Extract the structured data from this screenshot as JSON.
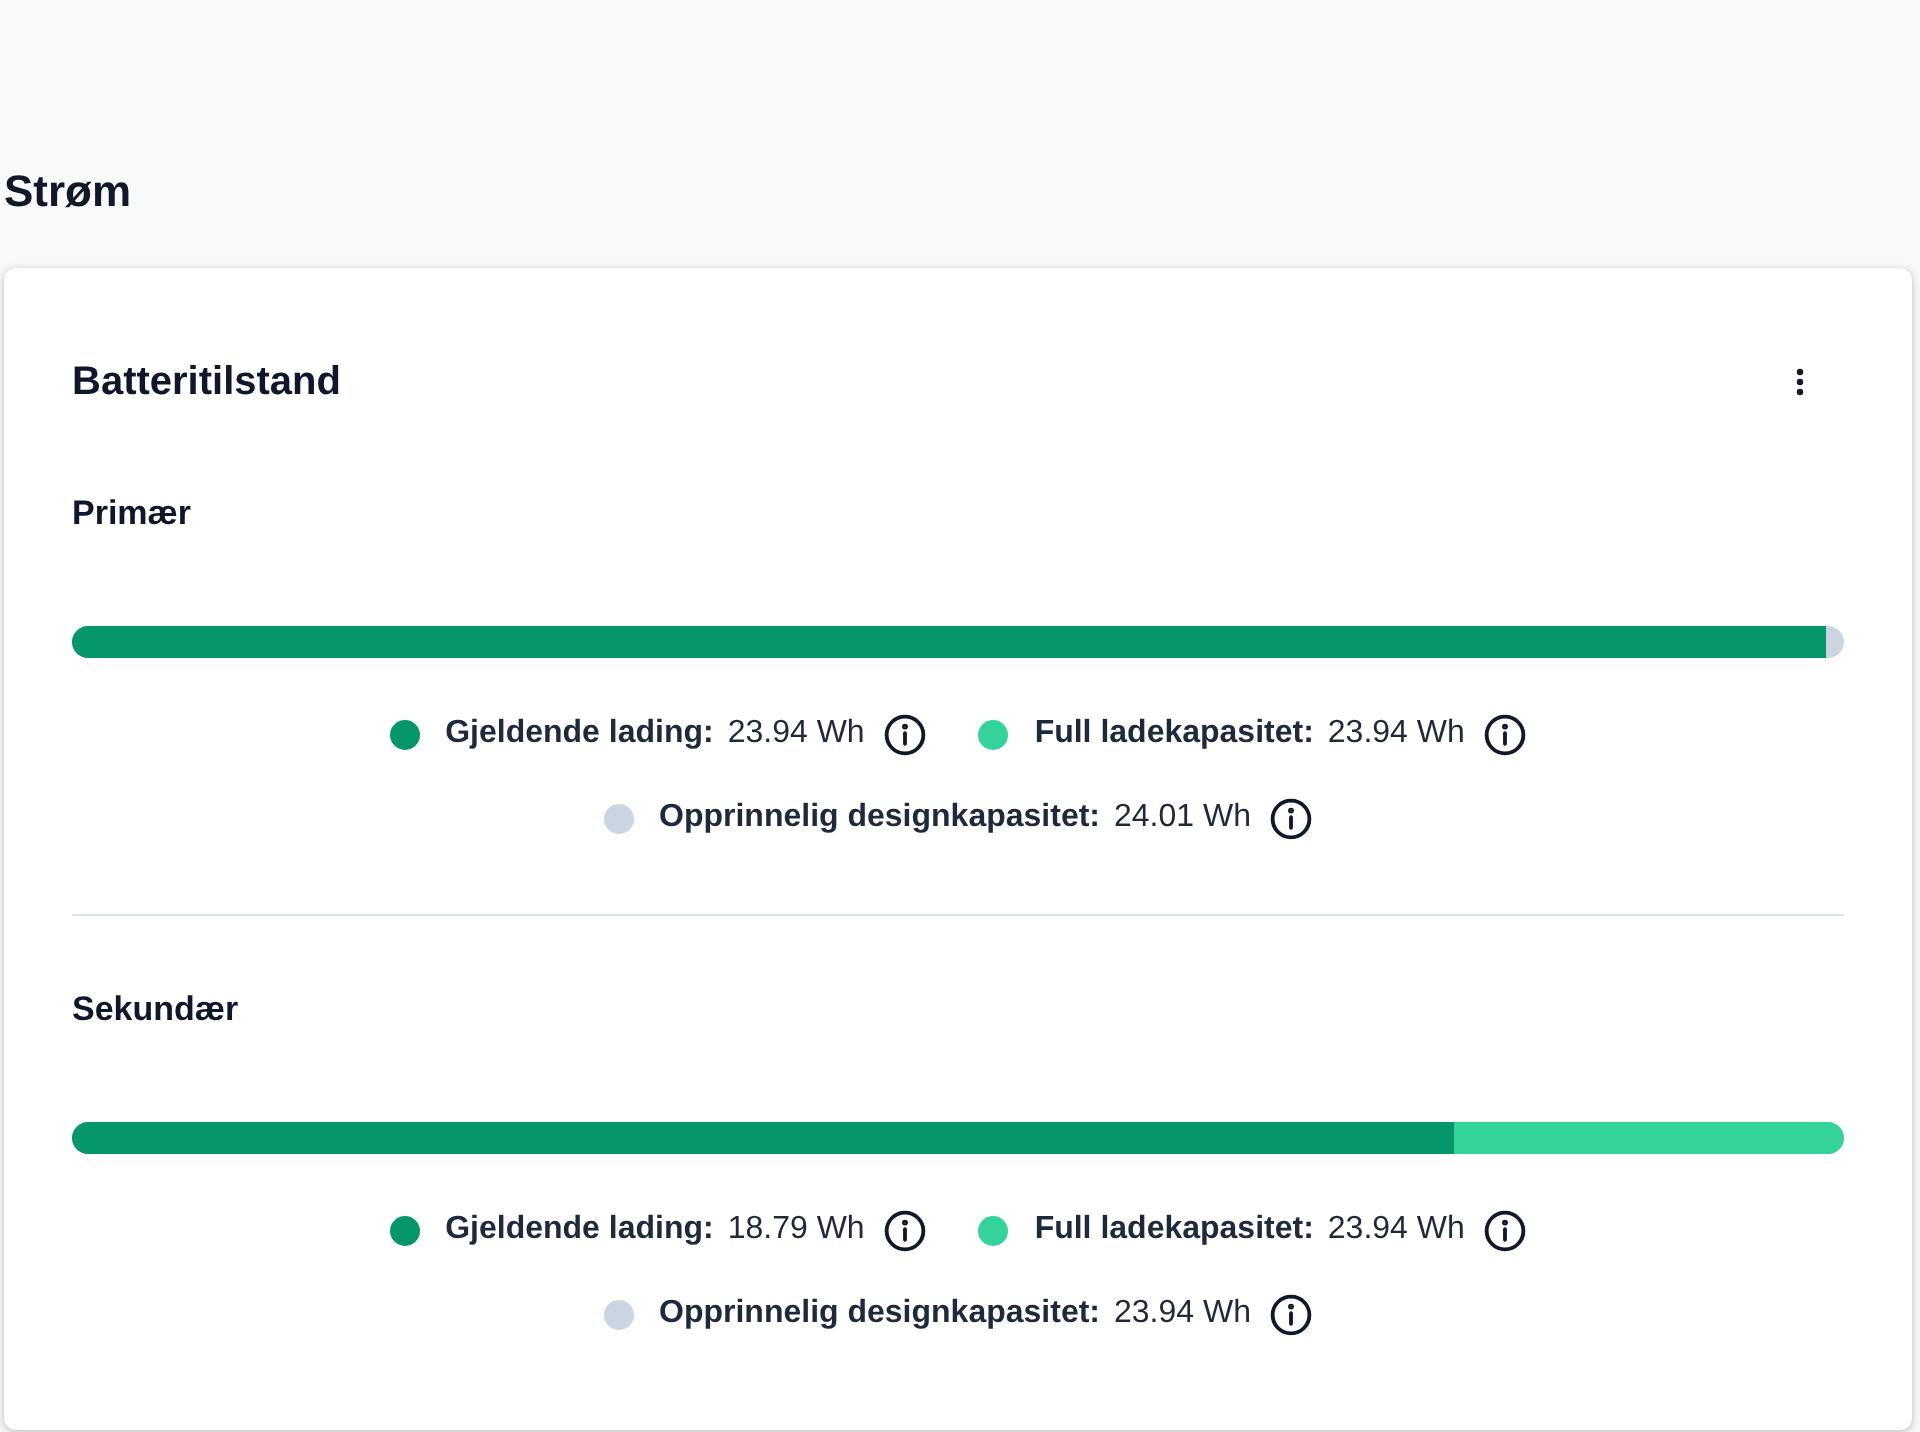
{
  "page": {
    "title": "Strøm"
  },
  "card": {
    "title": "Batteritilstand",
    "sections": [
      {
        "title": "Primær",
        "bar": {
          "segments": [
            {
              "color": "#059669",
              "level": 0.99
            }
          ]
        },
        "legend": [
          {
            "label": "Gjeldende lading:",
            "value": "23.94 Wh",
            "color": "#059669"
          },
          {
            "label": "Full ladekapasitet:",
            "value": "23.94 Wh",
            "color": "#34d399"
          },
          {
            "label": "Opprinnelig designkapasitet:",
            "value": "24.01 Wh",
            "color": "#cbd5e1"
          }
        ]
      },
      {
        "title": "Sekundær",
        "bar": {
          "segments": [
            {
              "color": "#059669",
              "level": 0.78
            },
            {
              "color": "#34d399",
              "level": 0.22
            }
          ]
        },
        "legend": [
          {
            "label": "Gjeldende lading:",
            "value": "18.79 Wh",
            "color": "#059669"
          },
          {
            "label": "Full ladekapasitet:",
            "value": "23.94 Wh",
            "color": "#34d399"
          },
          {
            "label": "Opprinnelig designkapasitet:",
            "value": "23.94 Wh",
            "color": "#cbd5e1"
          }
        ]
      }
    ]
  }
}
